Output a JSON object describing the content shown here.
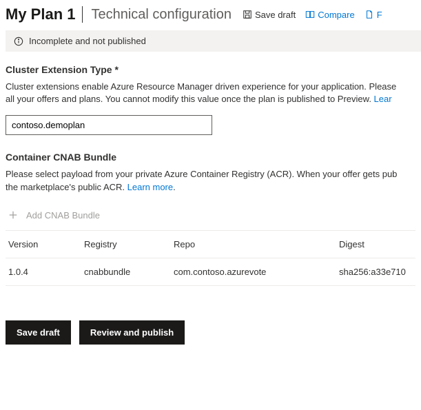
{
  "header": {
    "title": "My Plan 1",
    "subtitle": "Technical configuration"
  },
  "toolbar": {
    "save_draft": "Save draft",
    "compare": "Compare",
    "truncated": "F"
  },
  "status": {
    "text": "Incomplete and not published"
  },
  "cluster": {
    "label": "Cluster Extension Type",
    "desc_line1": "Cluster extensions enable Azure Resource Manager driven experience for your application. Please",
    "desc_line2_a": "all your offers and plans. You cannot modify this value once the plan is published to Preview. ",
    "desc_learn": "Lear",
    "value": "contoso.demoplan"
  },
  "cnab": {
    "label": "Container CNAB Bundle",
    "desc_line1": "Please select payload from your private Azure Container Registry (ACR). When your offer gets pub",
    "desc_line2_a": "the marketplace's public ACR. ",
    "desc_learn": "Learn more",
    "desc_period": ".",
    "add_label": "Add CNAB Bundle",
    "columns": {
      "version": "Version",
      "registry": "Registry",
      "repo": "Repo",
      "digest": "Digest"
    },
    "rows": [
      {
        "version": "1.0.4",
        "registry": "cnabbundle",
        "repo": "com.contoso.azurevote",
        "digest": "sha256:a33e710"
      }
    ]
  },
  "footer": {
    "save_draft": "Save draft",
    "review_publish": "Review and publish"
  }
}
